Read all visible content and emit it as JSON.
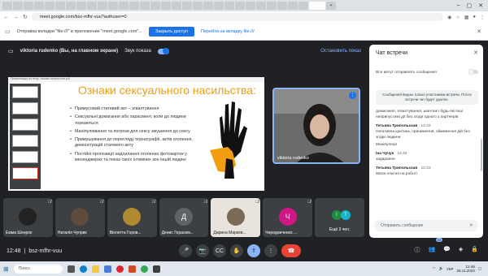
{
  "browser": {
    "url": "meet.google.com/bsz-mfhr-vuu?authuser=0",
    "tabs_count": 32
  },
  "infobar": {
    "text": "Отправка вкладки \"file:///\" в приложение \"meet.google.com\"...",
    "allow_label": "Закрыть доступ",
    "switch_label": "Перейти на вкладку file:///"
  },
  "presbar": {
    "name": "viktoria rudenko (Вы, на главном экране)",
    "sound_label": "Звук показа",
    "stop_label": "Остановить показ"
  },
  "slide": {
    "window_title": "Презентация на тему: ознаки насильства.pdf",
    "title": "Ознаки сексуального насильства:",
    "bullets": [
      "Примусовий статевий акт – згвалтування",
      "Сексуальні домагання або харасмент, коли до людини торкаються",
      "Маніпулювання та погрози для сексу змушення до сексу",
      "Примушування до перегляду порнографії, актів оголення, демонстрацій статевого акту",
      "Постійні пропозиції надсилання оголених фотокарток у месенджерах та показ своїх інтимних зон іншій людині"
    ]
  },
  "speaker": {
    "name": "viktoria rudenko"
  },
  "tiles": [
    {
      "name": "Емма Шенрок",
      "initial": "",
      "color": "#3c4043"
    },
    {
      "name": "Наталія Чуприк",
      "initial": "",
      "color": "#5f4b3b"
    },
    {
      "name": "Віолетта Горов...",
      "initial": "",
      "color": "#b08a2e"
    },
    {
      "name": "Денис Герасим...",
      "initial": "Д",
      "color": "#5f6368"
    },
    {
      "name": "Дарина Маркев...",
      "initial": "",
      "color": "#7a6a58"
    },
    {
      "name": "Чередниченко ...",
      "initial": "Ч",
      "color": "#d01884"
    },
    {
      "name": "Ещё 3 чел.",
      "initial": "I T",
      "color": "#1e8e3e"
    }
  ],
  "controls": {
    "time": "12:48",
    "code": "bsz-mfhr-vuu",
    "participants_badge": "10"
  },
  "chat": {
    "title": "Чат встречи",
    "toggle_label": "Все могут отправлять сообщения",
    "notice": "Сообщения видны только участникам встречи. После встречи чат будет удален.",
    "messages": [
      {
        "sender": "",
        "time": "",
        "text": "домагання, згвалтування, шантаж і будь-які інші неприпустимі дії без згоди одного з партнерів"
      },
      {
        "sender": "Тетьяна Трипольская",
        "time": "12:42",
        "text": "Негативна критика, приниження, обмеження дій без згоди людини"
      },
      {
        "sender": "",
        "time": "",
        "text": "Маніпуляції"
      },
      {
        "sender": "Іна Чучук",
        "time": "12:42",
        "text": "задирання"
      },
      {
        "sender": "Тетьяна Трипольская",
        "time": "12:43",
        "text": "Мала платня на роботі"
      }
    ],
    "input_placeholder": "Отправить сообщение"
  },
  "taskbar": {
    "search_placeholder": "Поиск",
    "lang": "УКР",
    "clock_time": "12:48",
    "clock_date": "28.11.2023"
  }
}
